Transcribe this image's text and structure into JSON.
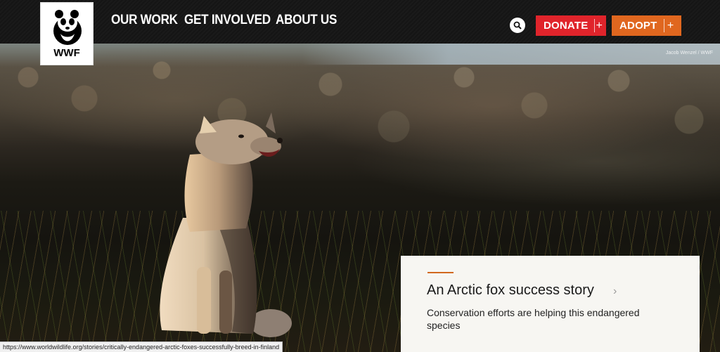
{
  "brand": {
    "logo_text": "WWF"
  },
  "nav": {
    "items": [
      {
        "label": "OUR WORK"
      },
      {
        "label": "GET INVOLVED"
      },
      {
        "label": "ABOUT US"
      }
    ]
  },
  "actions": {
    "donate_label": "DONATE",
    "adopt_label": "ADOPT",
    "plus_symbol": "+"
  },
  "hero": {
    "photo_credit": "Jacob Wenzel / WWF"
  },
  "story": {
    "title": "An Arctic fox success story",
    "chevron": "›",
    "description": "Conservation efforts are helping this endangered species"
  },
  "status_bar": {
    "url": "https://www.worldwildlife.org/stories/critically-endangered-arctic-foxes-successfully-breed-in-finland"
  },
  "colors": {
    "donate": "#e0242b",
    "adopt": "#e0671f",
    "accent_rule": "#d2691e",
    "nav_bg": "#151515"
  }
}
